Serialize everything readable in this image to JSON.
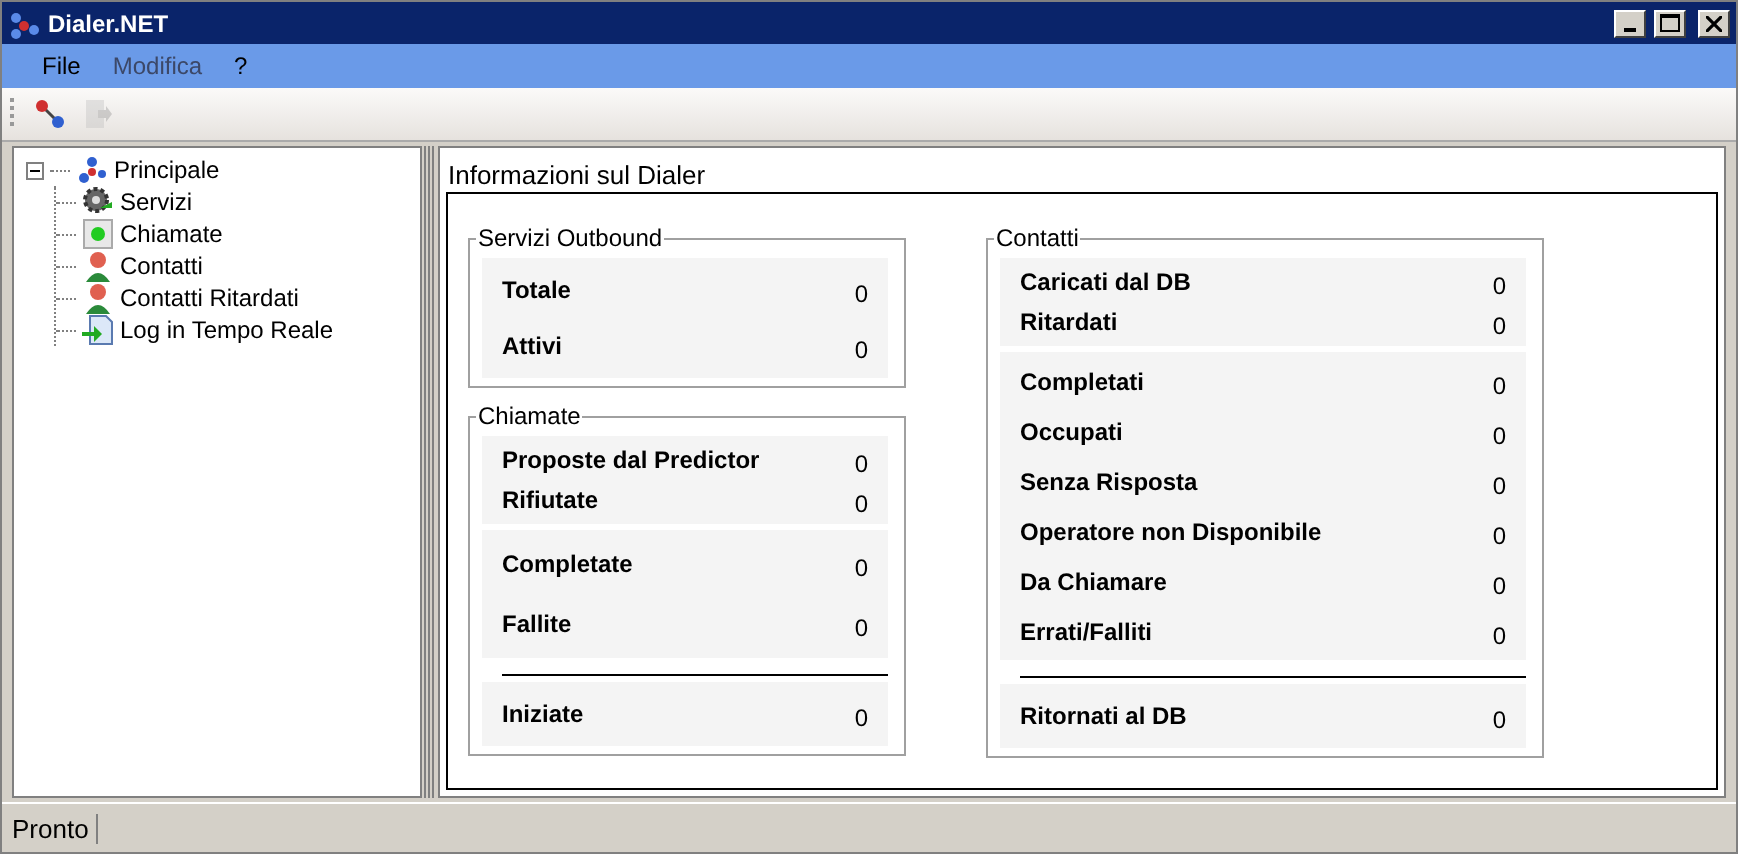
{
  "window": {
    "title": "Dialer.NET"
  },
  "menu": [
    {
      "label": "File",
      "disabled": false
    },
    {
      "label": "Modifica",
      "disabled": true
    },
    {
      "label": "?",
      "disabled": false
    }
  ],
  "toolbar": [
    {
      "kind": "connect",
      "disabled": false
    },
    {
      "kind": "exit",
      "disabled": true
    }
  ],
  "tree": [
    {
      "label": "Principale",
      "expanded": true,
      "children": [
        {
          "label": "Servizi"
        },
        {
          "label": "Chiamate"
        },
        {
          "label": "Contatti"
        },
        {
          "label": "Contatti Ritardati"
        },
        {
          "label": "Log in Tempo Reale"
        }
      ]
    }
  ],
  "panel": {
    "title": "Informazioni sul Dialer",
    "columns": [
      [
        {
          "title": "Servizi Outbound",
          "sections": [
            {
              "divider_before": false,
              "rows": [
                {
                  "label": "Totale",
                  "value": "0"
                },
                {
                  "label": "Attivi",
                  "value": "0"
                }
              ]
            }
          ]
        },
        {
          "title": "Chiamate",
          "sections": [
            {
              "divider_before": false,
              "rows": [
                {
                  "label": "Proposte dal Predictor",
                  "value": "0"
                },
                {
                  "label": "Rifiutate",
                  "value": "0"
                }
              ]
            },
            {
              "divider_before": false,
              "rows": [
                {
                  "label": "Completate",
                  "value": "0"
                },
                {
                  "label": "Fallite",
                  "value": "0"
                }
              ]
            },
            {
              "divider_before": true,
              "rows": [
                {
                  "label": "Iniziate",
                  "value": "0"
                }
              ]
            }
          ]
        }
      ],
      [
        {
          "title": "Contatti",
          "sections": [
            {
              "divider_before": false,
              "rows": [
                {
                  "label": "Caricati dal DB",
                  "value": "0"
                },
                {
                  "label": "Ritardati",
                  "value": "0"
                }
              ]
            },
            {
              "divider_before": false,
              "rows": [
                {
                  "label": "Completati",
                  "value": "0"
                },
                {
                  "label": "Occupati",
                  "value": "0"
                },
                {
                  "label": "Senza Risposta",
                  "value": "0"
                },
                {
                  "label": "Operatore non Disponibile",
                  "value": "0"
                },
                {
                  "label": "Da Chiamare",
                  "value": "0"
                },
                {
                  "label": "Errati/Falliti",
                  "value": "0"
                }
              ]
            },
            {
              "divider_before": true,
              "rows": [
                {
                  "label": "Ritornati al DB",
                  "value": "0"
                }
              ]
            }
          ]
        }
      ]
    ]
  },
  "status_bar": {
    "text": "Pronto"
  }
}
